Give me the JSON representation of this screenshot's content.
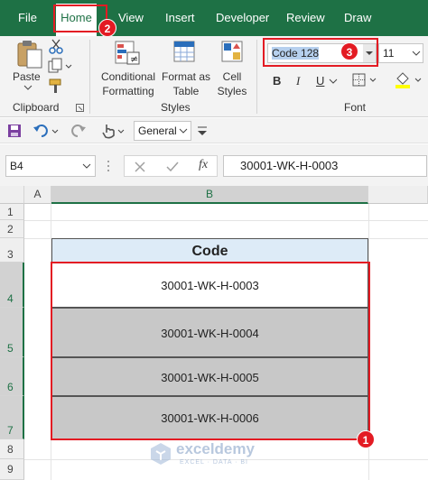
{
  "tabs": [
    {
      "label": "File"
    },
    {
      "label": "Home"
    },
    {
      "label": "View"
    },
    {
      "label": "Insert"
    },
    {
      "label": "Developer"
    },
    {
      "label": "Review"
    },
    {
      "label": "Draw"
    }
  ],
  "ribbon": {
    "paste_label": "Paste",
    "clipboard_label": "Clipboard",
    "conditional_formatting": [
      "Conditional",
      "Formatting"
    ],
    "format_as_table": [
      "Format as",
      "Table"
    ],
    "cell_styles": [
      "Cell",
      "Styles"
    ],
    "styles_label": "Styles",
    "font_name": "Code 128",
    "font_size": "11",
    "font_label": "Font",
    "bold": "B",
    "italic": "I",
    "underline": "U"
  },
  "qat": {
    "number_format": "General"
  },
  "formula_bar": {
    "name_box": "B4",
    "fx": "fx",
    "content": "30001-WK-H-0003"
  },
  "grid": {
    "columns": [
      "A",
      "B"
    ],
    "rows": [
      "1",
      "2",
      "3",
      "4",
      "5",
      "6",
      "7",
      "8",
      "9"
    ],
    "header": "Code",
    "codes": [
      "30001-WK-H-0003",
      "30001-WK-H-0004",
      "30001-WK-H-0005",
      "30001-WK-H-0006"
    ]
  },
  "callouts": [
    "1",
    "2",
    "3"
  ],
  "watermark": {
    "name": "exceldemy",
    "tagline": "EXCEL · DATA · BI"
  },
  "colors": {
    "excel_green": "#1e7145",
    "highlight_red": "#e31b23",
    "selected_cell": "#c8c8c8",
    "header_fill": "#ddebf7"
  }
}
